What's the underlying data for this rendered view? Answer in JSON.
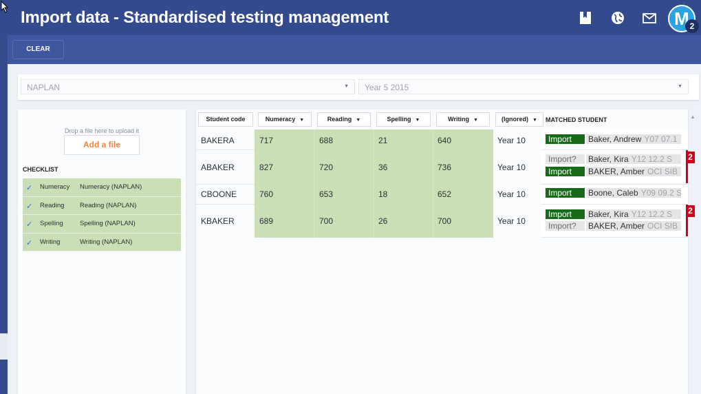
{
  "app": {
    "title": "Import data - Standardised testing management",
    "avatar_letter": "M",
    "avatar_count": "2",
    "icons": [
      "bookmark-icon",
      "globe-icon",
      "mail-icon"
    ]
  },
  "toolbar": {
    "clear_label": "CLEAR"
  },
  "filters": {
    "test": "NAPLAN",
    "cohort": "Year 5 2015"
  },
  "upload": {
    "drop_text": "Drop a file here to upload it",
    "add_file_label": "Add a file"
  },
  "checklist": {
    "title": "CHECKLIST",
    "items": [
      {
        "name": "Numeracy",
        "source": "Numeracy (NAPLAN)"
      },
      {
        "name": "Reading",
        "source": "Reading (NAPLAN)"
      },
      {
        "name": "Spelling",
        "source": "Spelling (NAPLAN)"
      },
      {
        "name": "Writing",
        "source": "Writing (NAPLAN)"
      }
    ]
  },
  "table": {
    "columns": [
      "Student code",
      "Numeracy",
      "Reading",
      "Spelling",
      "Writing",
      "(Ignored)"
    ],
    "matched_header": "MATCHED STUDENT",
    "rows": [
      {
        "code": "BAKERA",
        "numeracy": "717",
        "reading": "688",
        "spelling": "21",
        "writing": "640",
        "year": "Year 10",
        "count": "",
        "matches": [
          {
            "action": "Import",
            "name": "Baker, Andrew",
            "detail": "Y07 07.1"
          }
        ]
      },
      {
        "code": "ABAKER",
        "numeracy": "827",
        "reading": "720",
        "spelling": "36",
        "writing": "736",
        "year": "Year 10",
        "count": "2",
        "matches": [
          {
            "action": "Import?",
            "name": "Baker, Kira",
            "detail": "Y12 12.2 S"
          },
          {
            "action": "Import",
            "name": "BAKER, Amber",
            "detail": "OCI SIB"
          }
        ]
      },
      {
        "code": "CBOONE",
        "numeracy": "760",
        "reading": "653",
        "spelling": "18",
        "writing": "652",
        "year": "Year 10",
        "count": "",
        "matches": [
          {
            "action": "Import",
            "name": "Boone, Caleb",
            "detail": "Y09 09.2 S"
          }
        ]
      },
      {
        "code": "KBAKER",
        "numeracy": "689",
        "reading": "700",
        "spelling": "26",
        "writing": "700",
        "year": "Year 10",
        "count": "2",
        "matches": [
          {
            "action": "Import",
            "name": "Baker, Kira",
            "detail": "Y12 12.2 S"
          },
          {
            "action": "Import?",
            "name": "BAKER, Amber",
            "detail": "OCI SIB"
          }
        ]
      }
    ]
  }
}
